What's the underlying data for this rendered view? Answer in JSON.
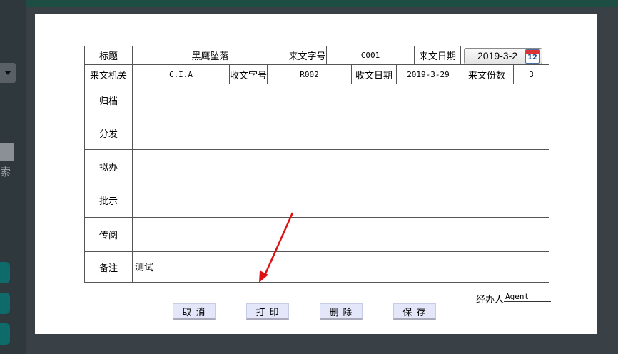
{
  "sidebar": {
    "search_fragment": "索"
  },
  "form": {
    "row1": {
      "title_label": "标题",
      "title_value": "黑鹰坠落",
      "doc_no_label": "来文字号",
      "doc_no_value": "C001",
      "date_label": "来文日期",
      "date_value": "2019-3-2",
      "calendar_day": "12"
    },
    "row2": {
      "org_label": "来文机关",
      "org_value": "C.I.A",
      "recv_no_label": "收文字号",
      "recv_no_value": "R002",
      "recv_date_label": "收文日期",
      "recv_date_value": "2019-3-29",
      "copies_label": "来文份数",
      "copies_value": "3"
    },
    "rows": [
      {
        "label": "归档",
        "value": ""
      },
      {
        "label": "分发",
        "value": ""
      },
      {
        "label": "拟办",
        "value": ""
      },
      {
        "label": "批示",
        "value": ""
      },
      {
        "label": "传阅",
        "value": ""
      },
      {
        "label": "备注",
        "value": "测试"
      }
    ]
  },
  "handler": {
    "label": "经办人",
    "value": "Agent"
  },
  "buttons": {
    "cancel": "取 消",
    "print": "打 印",
    "delete": "删 除",
    "save": "保 存"
  },
  "colors": {
    "panel": "#ffffff",
    "button_bg": "#e4e6fa",
    "arrow": "#dd1111",
    "sidebar": "#2f383d",
    "teal": "#0f6a6a"
  }
}
